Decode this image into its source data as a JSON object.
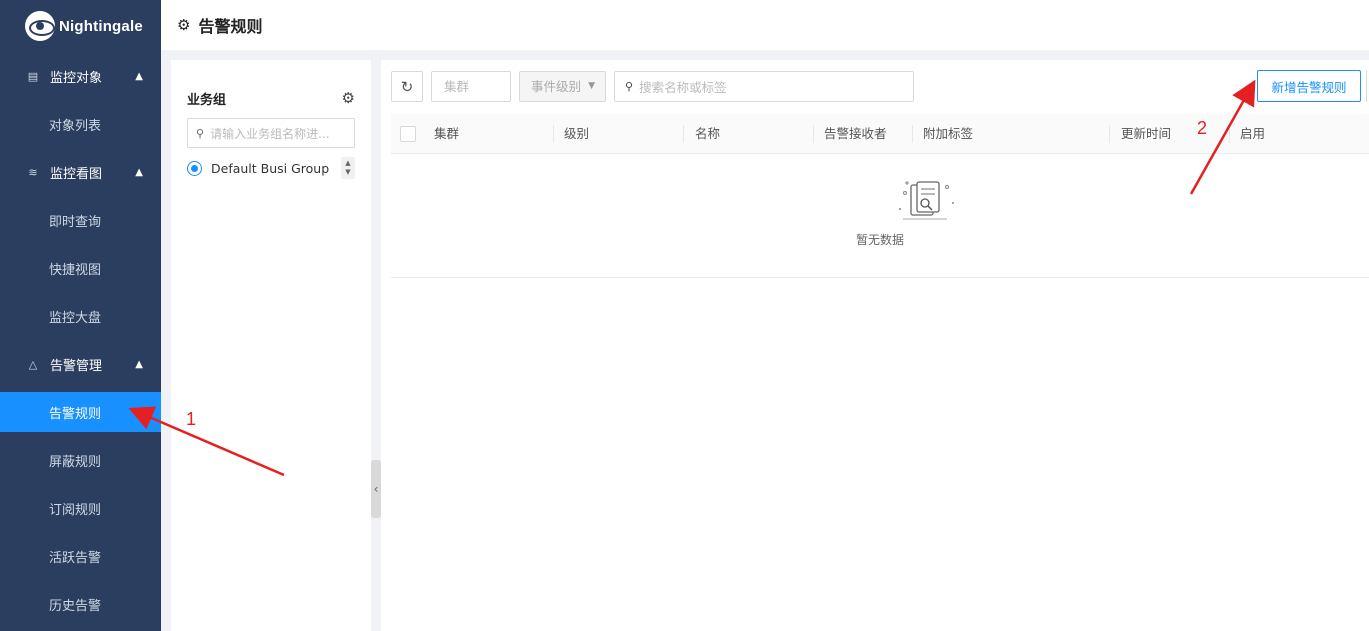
{
  "app": {
    "logo_text": "Nightingale"
  },
  "header": {
    "title": "告警规则"
  },
  "sidebar": {
    "groups": [
      {
        "label": "监控对象",
        "items": [
          "对象列表"
        ]
      },
      {
        "label": "监控看图",
        "items": [
          "即时查询",
          "快捷视图",
          "监控大盘"
        ]
      },
      {
        "label": "告警管理",
        "items": [
          "告警规则",
          "屏蔽规则",
          "订阅规则",
          "活跃告警",
          "历史告警"
        ]
      }
    ],
    "active_item": "告警规则"
  },
  "group_panel": {
    "title": "业务组",
    "search_placeholder": "请输入业务组名称进...",
    "items": [
      "Default Busi Group"
    ]
  },
  "toolbar": {
    "cluster_placeholder": "集群",
    "level_placeholder": "事件级别",
    "search_placeholder": "搜索名称或标签",
    "add_button": "新增告警规则"
  },
  "table": {
    "columns": [
      "集群",
      "级别",
      "名称",
      "告警接收者",
      "附加标签",
      "更新时间",
      "启用"
    ],
    "empty_text": "暂无数据"
  },
  "annotations": {
    "label_1": "1",
    "label_2": "2",
    "arrow_color": "#e52020"
  },
  "colors": {
    "sidebar_bg": "#2c3e5f",
    "accent": "#1890ff"
  }
}
